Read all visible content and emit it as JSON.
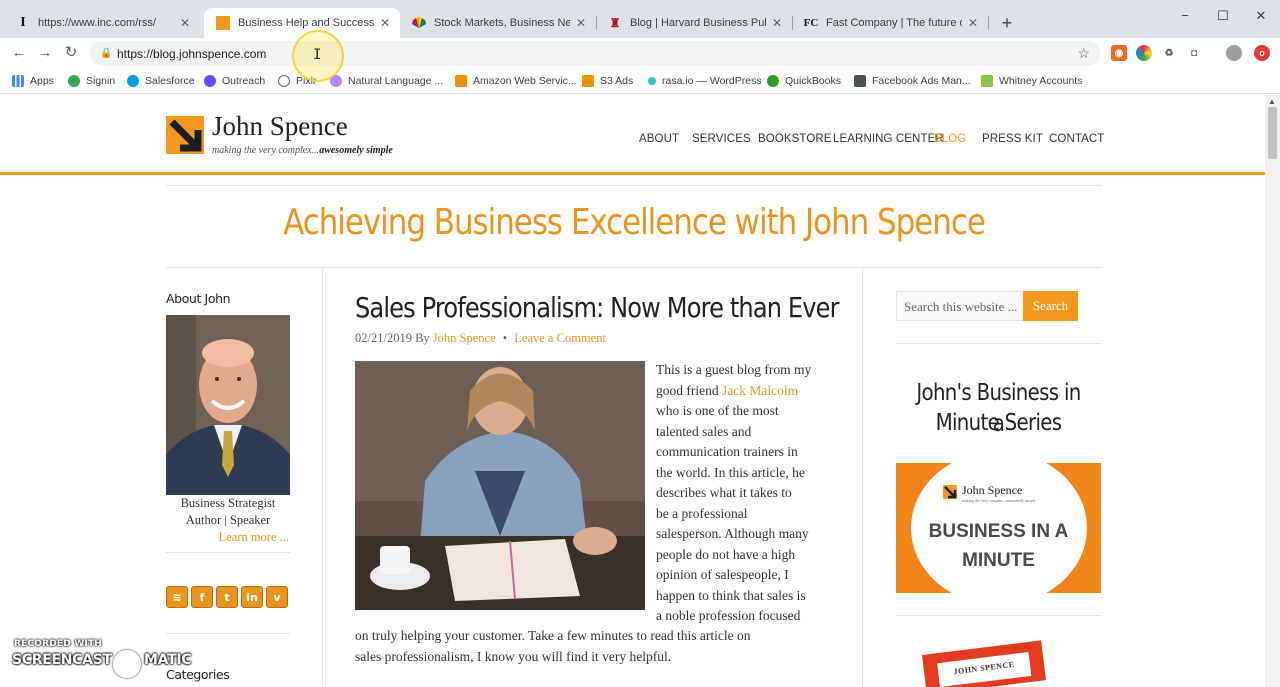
{
  "browser": {
    "tabs": [
      {
        "title": "https://www.inc.com/rss/",
        "favicon": "I",
        "active": false
      },
      {
        "title": "Business Help and Success Tips for",
        "favicon": "js",
        "active": true
      },
      {
        "title": "Stock Markets, Business News, Fi",
        "favicon": "nbc",
        "active": false
      },
      {
        "title": "Blog | Harvard Business Publishin",
        "favicon": "hbp",
        "active": false
      },
      {
        "title": "Fast Company | The future of bus",
        "favicon": "FC",
        "active": false
      }
    ],
    "new_tab": "+",
    "window": {
      "minimize": "−",
      "maximize": "☐",
      "close": "✕"
    },
    "url": "https://blog.johnspence.com",
    "bookmarks": [
      {
        "label": "Apps",
        "color": "#4285f4"
      },
      {
        "label": "Signin",
        "color": "#34a853"
      },
      {
        "label": "Salesforce",
        "color": "#00a1e0"
      },
      {
        "label": "Outreach",
        "color": "#5951ff"
      },
      {
        "label": "Pixlr",
        "color": "#777777"
      },
      {
        "label": "Natural Language ...",
        "color": "#b388ff"
      },
      {
        "label": "Amazon Web Servic...",
        "color": "#f29100"
      },
      {
        "label": "S3 Ads",
        "color": "#f29100"
      },
      {
        "label": "rasa.io — WordPress",
        "color": "#2ec4b6"
      },
      {
        "label": "QuickBooks",
        "color": "#2ca01c"
      },
      {
        "label": "Facebook Ads Man...",
        "color": "#4b4f56"
      },
      {
        "label": "Whitney Accounts",
        "color": "#8bc34a"
      }
    ]
  },
  "site": {
    "logo_name": "John Spence",
    "logo_tagline_lead": "making the very complex...",
    "logo_tagline_strong": "awesomely simple",
    "nav": [
      "ABOUT",
      "SERVICES",
      "BOOKSTORE",
      "LEARNING CENTER",
      "BLOG",
      "PRESS KIT",
      "CONTACT"
    ],
    "nav_active": "BLOG",
    "accent": "#f39a1e",
    "page_title": "Achieving Business Excellence with John Spence"
  },
  "left_sidebar": {
    "about_heading": "About John",
    "bio_line1": "Business Strategist",
    "bio_line2": "Author | Speaker",
    "learn_more": "Learn more ...",
    "social": [
      "rss-icon",
      "facebook-icon",
      "twitter-icon",
      "linkedin-icon",
      "vimeo-icon"
    ],
    "categories_heading": "Categories"
  },
  "post": {
    "title": "Sales Professionalism: Now More than Ever",
    "date": "02/21/2019",
    "by": "By",
    "author": "John Spence",
    "sep": "•",
    "comment_link": "Leave a Comment",
    "body_lines": [
      "This is a guest blog from my",
      "good friend",
      "who is one of the most",
      "talented sales and",
      "communication trainers in",
      "the world. In this article, he",
      "describes what it takes to",
      "be a professional",
      "salesperson. Although many",
      "people do not have a high",
      "opinion of salespeople, I",
      "happen to think that sales is",
      "a noble profession focused"
    ],
    "friend_link": "Jack Malcolm",
    "body_wide_lines": [
      "on truly helping your customer. Take a few minutes to read this article on",
      "sales professionalism, I know you will find it very helpful."
    ]
  },
  "right_sidebar": {
    "search_placeholder": "Search this website ...",
    "search_button": "Search",
    "widget_title_line1": "John's Business in a",
    "widget_title_line2": "Minute Series",
    "banner_logo": "John Spence",
    "banner_logo_tag": "making the very complex...awesomely simple",
    "banner_line1": "BUSINESS IN A",
    "banner_line2": "MINUTE",
    "book_label": "JOHN SPENCE"
  },
  "watermark": {
    "top": "RECORDED WITH",
    "main_left": "SCREENCAST",
    "main_right": "MATIC"
  }
}
